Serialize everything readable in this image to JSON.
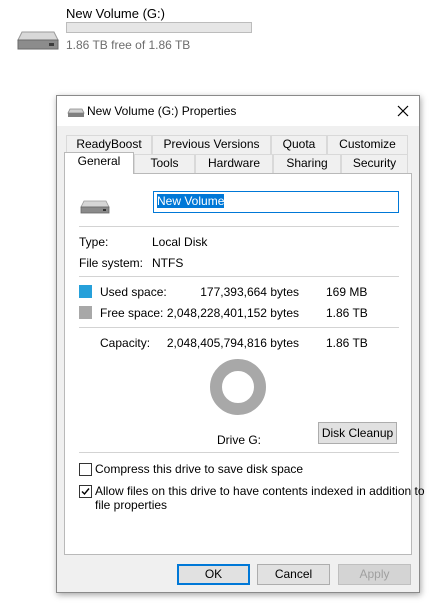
{
  "drive": {
    "name": "New Volume (G:)",
    "free_text": "1.86 TB free of 1.86 TB",
    "used_fraction": 0.0001
  },
  "dialog": {
    "title": "New Volume (G:) Properties",
    "tabs_back": [
      "ReadyBoost",
      "Previous Versions",
      "Quota",
      "Customize"
    ],
    "tabs_front": [
      "General",
      "Tools",
      "Hardware",
      "Sharing",
      "Security"
    ],
    "active_tab": "General",
    "volume_name": "New Volume",
    "type_label": "Type:",
    "type_value": "Local Disk",
    "fs_label": "File system:",
    "fs_value": "NTFS",
    "used_label": "Used space:",
    "used_bytes": "177,393,664 bytes",
    "used_size": "169 MB",
    "free_label": "Free space:",
    "free_bytes": "2,048,228,401,152 bytes",
    "free_size": "1.86 TB",
    "capacity_label": "Capacity:",
    "capacity_bytes": "2,048,405,794,816 bytes",
    "capacity_size": "1.86 TB",
    "drive_label": "Drive G:",
    "disk_cleanup": "Disk Cleanup",
    "compress_label": "Compress this drive to save disk space",
    "compress_checked": false,
    "index_label_line1": "Allow files on this drive to have contents indexed in addition to",
    "index_label_line2": "file properties",
    "index_checked": true,
    "ok": "OK",
    "cancel": "Cancel",
    "apply": "Apply"
  },
  "colors": {
    "used": "#26a0da",
    "free": "#a8a8a8",
    "accent": "#0078d7"
  }
}
